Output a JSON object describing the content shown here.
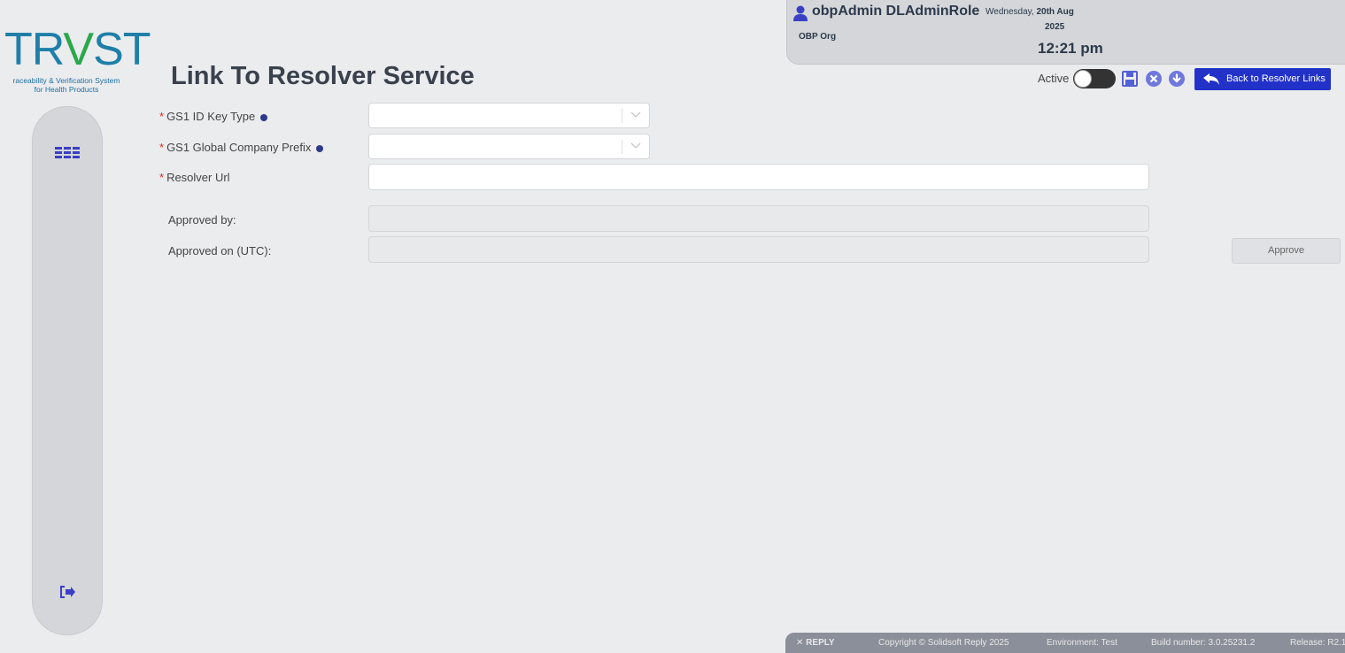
{
  "logo": {
    "word_pre": "TR",
    "word_v": "V",
    "word_post": "ST",
    "tagline_line1": "raceability & Verification System",
    "tagline_line2": "for Health Products"
  },
  "user": {
    "name": "obpAdmin DLAdminRole",
    "org": "OBP Org",
    "date_weekday": "Wednesday,",
    "date_day_month": "20th Aug",
    "date_year": "2025",
    "time": "12:21 pm"
  },
  "page": {
    "title": "Link To Resolver Service"
  },
  "toolbar": {
    "active_label": "Active",
    "active_on": false,
    "back_label": "Back to Resolver Links"
  },
  "form": {
    "gs1_id_key_type_label": "GS1 ID Key Type",
    "gs1_id_key_type_value": "",
    "company_prefix_label": "GS1 Global Company Prefix",
    "company_prefix_value": "",
    "resolver_url_label": "Resolver Url",
    "resolver_url_value": "",
    "approved_by_label": "Approved by:",
    "approved_by_value": "",
    "approved_on_label": "Approved on (UTC):",
    "approved_on_value": "",
    "required_mark": "*",
    "approve_label": "Approve"
  },
  "footer": {
    "brand": "REPLY",
    "copyright": "Copyright © Solidsoft Reply 2025",
    "environment": "Environment: Test",
    "build": "Build number: 3.0.25231.2",
    "release": "Release: R2.1"
  },
  "colors": {
    "accent": "#2232c8",
    "required": "#e0261f",
    "sidebar": "#d4d6da",
    "footer": "#8a8f99"
  },
  "icons": [
    "user-icon",
    "menu-icon",
    "logout-icon",
    "save-icon",
    "cancel-icon",
    "download-icon",
    "back-arrow-icon",
    "info-icon",
    "chevron-down-icon"
  ]
}
